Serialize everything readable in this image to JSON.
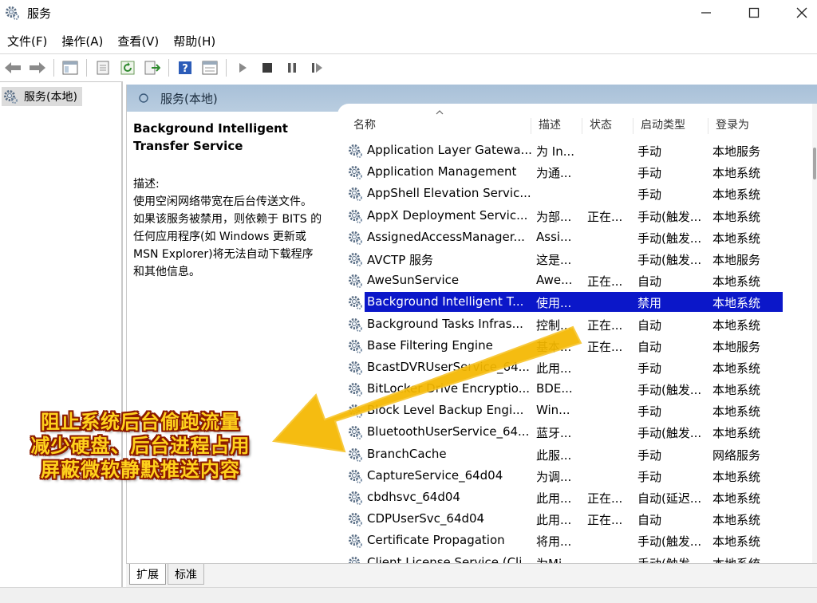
{
  "window": {
    "title": "服务"
  },
  "menu": [
    "文件(F)",
    "操作(A)",
    "查看(V)",
    "帮助(H)"
  ],
  "toolbar": {
    "icons": [
      "back-arrow-icon",
      "forward-arrow-icon",
      "console-tree-icon",
      "properties-icon",
      "refresh-icon",
      "export-icon",
      "help-icon",
      "view-icon",
      "play-icon",
      "stop-icon",
      "pause-icon",
      "restart-icon"
    ]
  },
  "tree": {
    "root_label": "服务(本地)"
  },
  "main": {
    "header_title": "服务(本地)"
  },
  "details": {
    "service_title": "Background Intelligent Transfer Service",
    "desc_label": "描述:",
    "desc_lines": [
      "使用空闲网络带宽在后台传送文件。",
      "如果该服务被禁用，则依赖于 BITS 的",
      "任何应用程序(如 Windows 更新或",
      "MSN Explorer)将无法自动下载程序",
      "和其他信息。"
    ]
  },
  "table": {
    "columns": [
      "名称",
      "描述",
      "状态",
      "启动类型",
      "登录为"
    ],
    "selected_index": 7,
    "rows": [
      [
        "Application Layer Gatewa...",
        "为 In...",
        "",
        "手动",
        "本地服务"
      ],
      [
        "Application Management",
        "为通...",
        "",
        "手动",
        "本地系统"
      ],
      [
        "AppShell Elevation Servic...",
        "",
        "",
        "手动",
        "本地系统"
      ],
      [
        "AppX Deployment Servic...",
        "为部...",
        "正在...",
        "手动(触发...",
        "本地系统"
      ],
      [
        "AssignedAccessManager...",
        "Assi...",
        "",
        "手动(触发...",
        "本地系统"
      ],
      [
        "AVCTP 服务",
        "这是...",
        "",
        "手动(触发...",
        "本地服务"
      ],
      [
        "AweSunService",
        "Awe...",
        "正在...",
        "自动",
        "本地系统"
      ],
      [
        "Background Intelligent T...",
        "使用...",
        "",
        "禁用",
        "本地系统"
      ],
      [
        "Background Tasks Infras...",
        "控制...",
        "正在...",
        "自动",
        "本地系统"
      ],
      [
        "Base Filtering Engine",
        "基本...",
        "正在...",
        "自动",
        "本地服务"
      ],
      [
        "BcastDVRUserService_64...",
        "此用...",
        "",
        "手动",
        "本地系统"
      ],
      [
        "BitLocker Drive Encryptio...",
        "BDE...",
        "",
        "手动(触发...",
        "本地系统"
      ],
      [
        "Block Level Backup Engi...",
        "Win...",
        "",
        "手动",
        "本地系统"
      ],
      [
        "BluetoothUserService_64...",
        "蓝牙...",
        "",
        "手动(触发...",
        "本地系统"
      ],
      [
        "BranchCache",
        "此服...",
        "",
        "手动",
        "网络服务"
      ],
      [
        "CaptureService_64d04",
        "为调...",
        "",
        "手动",
        "本地系统"
      ],
      [
        "cbdhsvc_64d04",
        "此用...",
        "正在...",
        "自动(延迟...",
        "本地系统"
      ],
      [
        "CDPUserSvc_64d04",
        "此用...",
        "正在...",
        "自动",
        "本地系统"
      ],
      [
        "Certificate Propagation",
        "将用...",
        "",
        "手动(触发...",
        "本地系统"
      ],
      [
        "Client License Service (Cli...",
        "为Mi...",
        "",
        "手动(触发...",
        "本地系统"
      ]
    ]
  },
  "tabs": [
    "扩展",
    "标准"
  ],
  "overlay": {
    "lines": [
      "阻止系统后台偷跑流量",
      "减少硬盘、后台进程占用",
      "屏蔽微软静默推送内容"
    ],
    "arrow_color": "#f5b800",
    "text_color": "#ffd21c"
  }
}
